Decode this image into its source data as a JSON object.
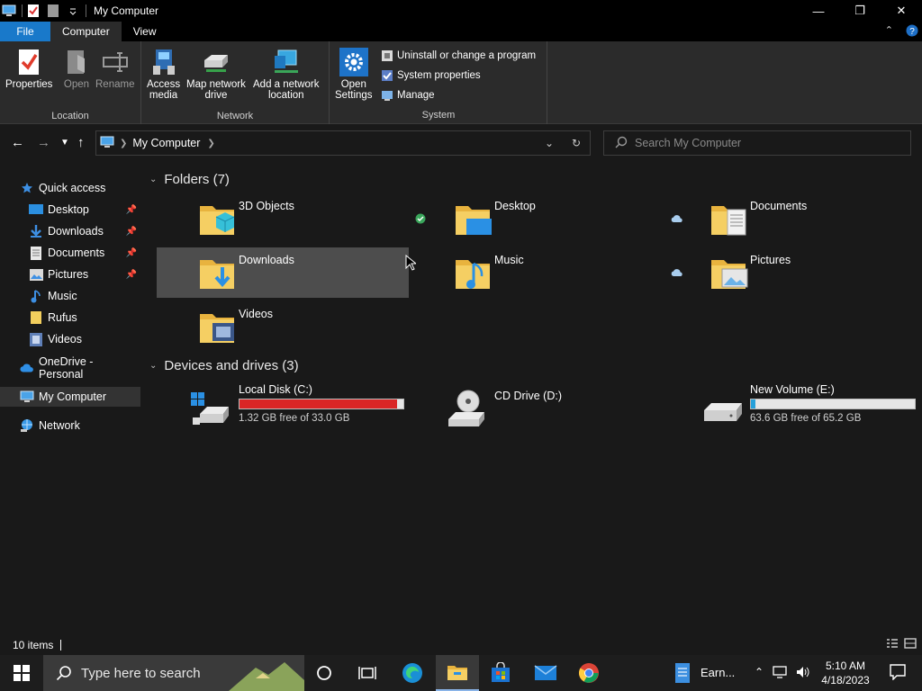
{
  "window": {
    "title": "My Computer"
  },
  "ribbon_tabs": [
    "File",
    "Computer",
    "View"
  ],
  "ribbon": {
    "location": {
      "label": "Location",
      "properties": "Properties",
      "open": "Open",
      "rename": "Rename"
    },
    "network": {
      "label": "Network",
      "access_media": "Access\nmedia",
      "map_drive": "Map network\ndrive",
      "add_location": "Add a network\nlocation"
    },
    "system": {
      "label": "System",
      "open_settings": "Open\nSettings",
      "uninstall": "Uninstall or change a program",
      "system_properties": "System properties",
      "manage": "Manage"
    }
  },
  "address": {
    "breadcrumb": "My Computer",
    "search_placeholder": "Search My Computer"
  },
  "nav": {
    "quick_access": "Quick access",
    "items": [
      "Desktop",
      "Downloads",
      "Documents",
      "Pictures",
      "Music",
      "Rufus",
      "Videos"
    ],
    "onedrive": "OneDrive - Personal",
    "my_computer": "My Computer",
    "network": "Network"
  },
  "folders": {
    "header": "Folders (7)",
    "items": [
      "3D Objects",
      "Desktop",
      "Documents",
      "Downloads",
      "Music",
      "Pictures",
      "Videos"
    ]
  },
  "drives": {
    "header": "Devices and drives (3)",
    "items": [
      {
        "name": "Local Disk (C:)",
        "free": "1.32 GB free of 33.0 GB",
        "used_fraction": 0.96,
        "bar_color": "#da2626"
      },
      {
        "name": "CD Drive (D:)",
        "free": ""
      },
      {
        "name": "New Volume (E:)",
        "free": "63.6 GB free of 65.2 GB",
        "used_fraction": 0.025,
        "bar_color": "#26a0da"
      }
    ]
  },
  "status": {
    "count": "10 items"
  },
  "taskbar": {
    "search_placeholder": "Type here to search",
    "app_label": "Earn...",
    "time": "5:10 AM",
    "date": "4/18/2023"
  }
}
